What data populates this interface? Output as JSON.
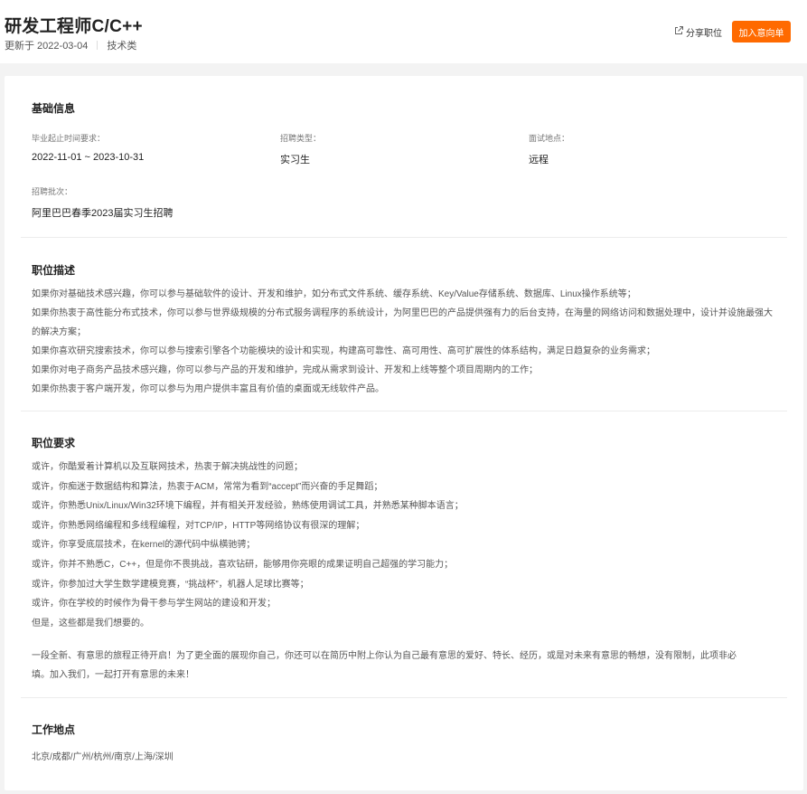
{
  "job": {
    "title": "研发工程师C/C++",
    "updated": "更新于 2022-03-04",
    "category": "技术类"
  },
  "actions": {
    "share_label": "分享职位",
    "apply_label": "加入意向单"
  },
  "basic_info": {
    "heading": "基础信息",
    "graduation_label": "毕业起止时间要求：",
    "graduation_value": "2022-11-01 ~ 2023-10-31",
    "type_label": "招聘类型：",
    "type_value": "实习生",
    "interview_label": "面试地点：",
    "interview_value": "远程",
    "batch_label": "招聘批次：",
    "batch_value": "阿里巴巴春季2023届实习生招聘"
  },
  "description": {
    "heading": "职位描述",
    "paragraphs": [
      "如果你对基础技术感兴趣，你可以参与基础软件的设计、开发和维护，如分布式文件系统、缓存系统、Key/Value存储系统、数据库、Linux操作系统等；",
      "如果你热衷于高性能分布式技术，你可以参与世界级规模的分布式服务调程序的系统设计，为阿里巴巴的产品提供强有力的后台支持，在海量的网络访问和数据处理中，设计并设施最强大的解决方案；",
      "如果你喜欢研究搜索技术，你可以参与搜索引擎各个功能模块的设计和实现，构建高可靠性、高可用性、高可扩展性的体系结构，满足日趋复杂的业务需求；",
      "如果你对电子商务产品技术感兴趣，你可以参与产品的开发和维护，完成从需求到设计、开发和上线等整个项目周期内的工作；",
      "如果你热衷于客户端开发，你可以参与为用户提供丰富且有价值的桌面或无线软件产品。"
    ]
  },
  "requirements": {
    "heading": "职位要求",
    "items": [
      "或许，你酷爱着计算机以及互联网技术，热衷于解决挑战性的问题；",
      "或许，你痴迷于数据结构和算法，热衷于ACM，常常为看到“accept”而兴奋的手足舞蹈；",
      "或许，你熟悉Unix/Linux/Win32环境下编程，并有相关开发经验，熟练使用调试工具，并熟悉某种脚本语言；",
      "或许，你熟悉网络编程和多线程编程，对TCP/IP，HTTP等网络协议有很深的理解；",
      "或许，你享受底层技术，在kernel的源代码中纵横驰骋；",
      "或许，你并不熟悉C，C++，但是你不畏挑战，喜欢钻研，能够用你亮眼的成果证明自己超强的学习能力；",
      "或许，你参加过大学生数学建模竞赛，“挑战杯”，机器人足球比赛等；",
      "或许，你在学校的时候作为骨干参与学生网站的建设和开发；",
      "但是，这些都是我们想要的。"
    ],
    "closing": [
      "一段全新、有意思的旅程正待开启！为了更全面的展现你自己，你还可以在简历中附上你认为自己最有意思的爱好、特长、经历，或是对未来有意思的畅想，没有限制，此项非必",
      "填。加入我们，一起打开有意思的未来！"
    ]
  },
  "location": {
    "heading": "工作地点",
    "cities": "北京/成都/广州/杭州/南京/上海/深圳"
  },
  "colors": {
    "accent": "#ff6a00",
    "page_bg": "#f3f3f3"
  }
}
